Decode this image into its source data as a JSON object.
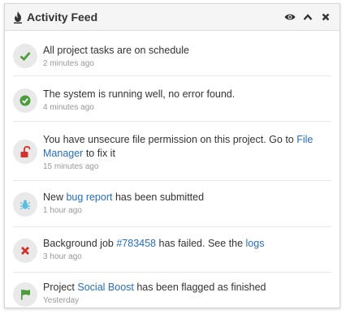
{
  "panel": {
    "title": "Activity Feed",
    "tools": [
      {
        "name": "eye-icon"
      },
      {
        "name": "chevron-up-icon"
      },
      {
        "name": "close-icon"
      }
    ]
  },
  "items": [
    {
      "icon": "check-icon",
      "color": "#4a9d3a",
      "segments": [
        {
          "t": "All project tasks are on schedule"
        }
      ],
      "time": "2 minutes ago"
    },
    {
      "icon": "check-circle-icon",
      "color": "#4a9d3a",
      "segments": [
        {
          "t": "The system is running well, no error found."
        }
      ],
      "time": "4 minutes ago"
    },
    {
      "icon": "unlock-icon",
      "color": "#d2322d",
      "segments": [
        {
          "t": "You have unsecure file permission on this project. Go to "
        },
        {
          "t": "File Manager",
          "link": true
        },
        {
          "t": " to fix it"
        }
      ],
      "time": "15 minutes ago"
    },
    {
      "icon": "bug-icon",
      "color": "#5bc0de",
      "segments": [
        {
          "t": "New "
        },
        {
          "t": "bug report",
          "link": true
        },
        {
          "t": " has been submitted"
        }
      ],
      "time": "1 hour ago"
    },
    {
      "icon": "x-icon",
      "color": "#d2322d",
      "segments": [
        {
          "t": "Background job "
        },
        {
          "t": "#783458",
          "link": true
        },
        {
          "t": " has failed. See the "
        },
        {
          "t": "logs",
          "link": true
        }
      ],
      "time": "3 hour ago"
    },
    {
      "icon": "flag-icon",
      "color": "#4a9d3a",
      "segments": [
        {
          "t": "Project "
        },
        {
          "t": "Social Boost",
          "link": true
        },
        {
          "t": " has been flagged as finished"
        }
      ],
      "time": "Yesterday"
    }
  ],
  "colors": {
    "link": "#2a6db3",
    "muted": "#999999",
    "header_bg": "#f5f5f5"
  }
}
